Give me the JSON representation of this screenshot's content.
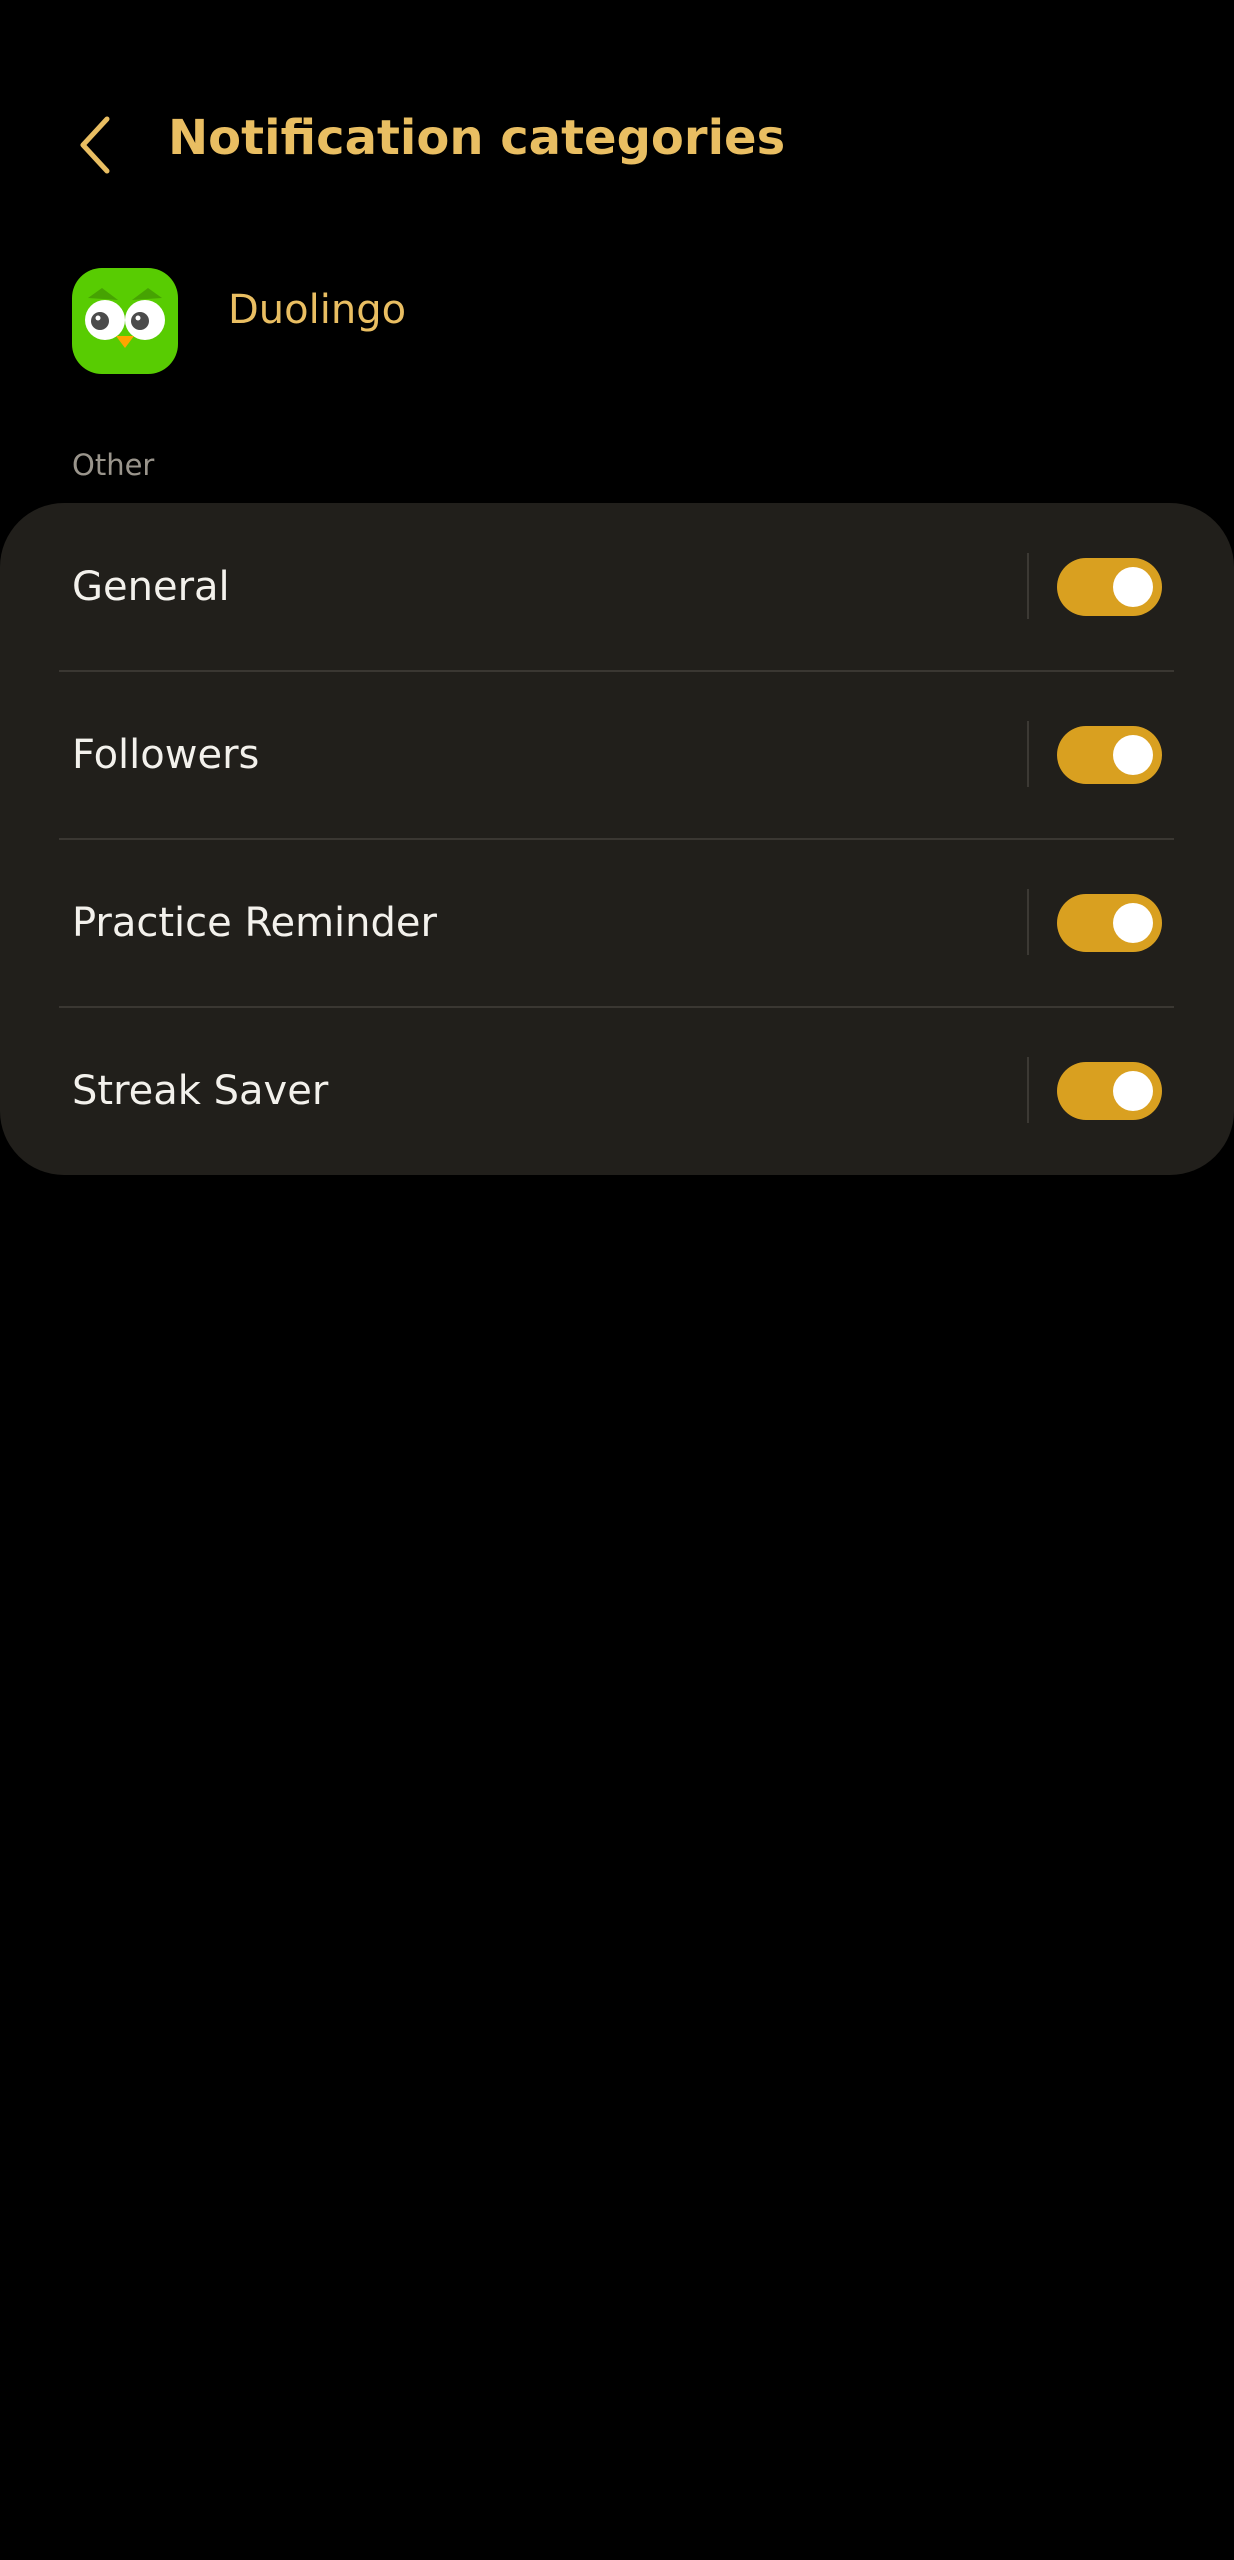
{
  "header": {
    "title": "Notification categories",
    "back_icon": "chevron-left-icon"
  },
  "app": {
    "name": "Duolingo",
    "icon": "duolingo-owl-icon"
  },
  "section": {
    "label": "Other"
  },
  "categories": [
    {
      "label": "General",
      "enabled": true
    },
    {
      "label": "Followers",
      "enabled": true
    },
    {
      "label": "Practice Reminder",
      "enabled": true
    },
    {
      "label": "Streak Saver",
      "enabled": true
    }
  ],
  "colors": {
    "accent": "#E9BE62",
    "toggle_on": "#D9A020",
    "card_bg": "#211F1B",
    "background": "#000000"
  }
}
